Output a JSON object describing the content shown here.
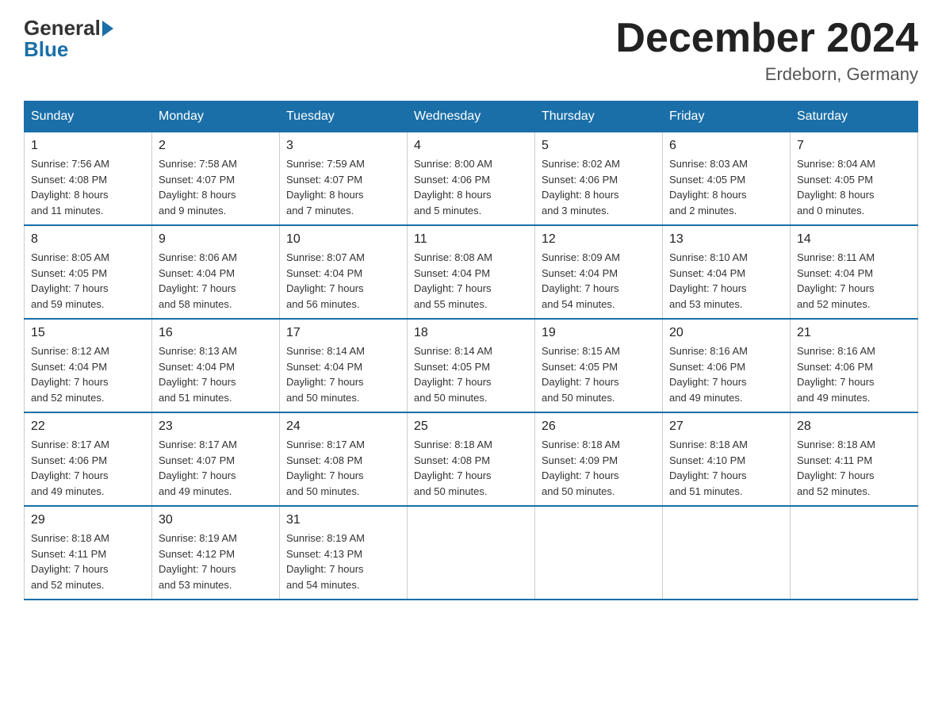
{
  "header": {
    "logo": {
      "general": "General",
      "blue": "Blue"
    },
    "title": "December 2024",
    "subtitle": "Erdeborn, Germany"
  },
  "days_of_week": [
    "Sunday",
    "Monday",
    "Tuesday",
    "Wednesday",
    "Thursday",
    "Friday",
    "Saturday"
  ],
  "weeks": [
    [
      {
        "day": "1",
        "info": "Sunrise: 7:56 AM\nSunset: 4:08 PM\nDaylight: 8 hours\nand 11 minutes."
      },
      {
        "day": "2",
        "info": "Sunrise: 7:58 AM\nSunset: 4:07 PM\nDaylight: 8 hours\nand 9 minutes."
      },
      {
        "day": "3",
        "info": "Sunrise: 7:59 AM\nSunset: 4:07 PM\nDaylight: 8 hours\nand 7 minutes."
      },
      {
        "day": "4",
        "info": "Sunrise: 8:00 AM\nSunset: 4:06 PM\nDaylight: 8 hours\nand 5 minutes."
      },
      {
        "day": "5",
        "info": "Sunrise: 8:02 AM\nSunset: 4:06 PM\nDaylight: 8 hours\nand 3 minutes."
      },
      {
        "day": "6",
        "info": "Sunrise: 8:03 AM\nSunset: 4:05 PM\nDaylight: 8 hours\nand 2 minutes."
      },
      {
        "day": "7",
        "info": "Sunrise: 8:04 AM\nSunset: 4:05 PM\nDaylight: 8 hours\nand 0 minutes."
      }
    ],
    [
      {
        "day": "8",
        "info": "Sunrise: 8:05 AM\nSunset: 4:05 PM\nDaylight: 7 hours\nand 59 minutes."
      },
      {
        "day": "9",
        "info": "Sunrise: 8:06 AM\nSunset: 4:04 PM\nDaylight: 7 hours\nand 58 minutes."
      },
      {
        "day": "10",
        "info": "Sunrise: 8:07 AM\nSunset: 4:04 PM\nDaylight: 7 hours\nand 56 minutes."
      },
      {
        "day": "11",
        "info": "Sunrise: 8:08 AM\nSunset: 4:04 PM\nDaylight: 7 hours\nand 55 minutes."
      },
      {
        "day": "12",
        "info": "Sunrise: 8:09 AM\nSunset: 4:04 PM\nDaylight: 7 hours\nand 54 minutes."
      },
      {
        "day": "13",
        "info": "Sunrise: 8:10 AM\nSunset: 4:04 PM\nDaylight: 7 hours\nand 53 minutes."
      },
      {
        "day": "14",
        "info": "Sunrise: 8:11 AM\nSunset: 4:04 PM\nDaylight: 7 hours\nand 52 minutes."
      }
    ],
    [
      {
        "day": "15",
        "info": "Sunrise: 8:12 AM\nSunset: 4:04 PM\nDaylight: 7 hours\nand 52 minutes."
      },
      {
        "day": "16",
        "info": "Sunrise: 8:13 AM\nSunset: 4:04 PM\nDaylight: 7 hours\nand 51 minutes."
      },
      {
        "day": "17",
        "info": "Sunrise: 8:14 AM\nSunset: 4:04 PM\nDaylight: 7 hours\nand 50 minutes."
      },
      {
        "day": "18",
        "info": "Sunrise: 8:14 AM\nSunset: 4:05 PM\nDaylight: 7 hours\nand 50 minutes."
      },
      {
        "day": "19",
        "info": "Sunrise: 8:15 AM\nSunset: 4:05 PM\nDaylight: 7 hours\nand 50 minutes."
      },
      {
        "day": "20",
        "info": "Sunrise: 8:16 AM\nSunset: 4:06 PM\nDaylight: 7 hours\nand 49 minutes."
      },
      {
        "day": "21",
        "info": "Sunrise: 8:16 AM\nSunset: 4:06 PM\nDaylight: 7 hours\nand 49 minutes."
      }
    ],
    [
      {
        "day": "22",
        "info": "Sunrise: 8:17 AM\nSunset: 4:06 PM\nDaylight: 7 hours\nand 49 minutes."
      },
      {
        "day": "23",
        "info": "Sunrise: 8:17 AM\nSunset: 4:07 PM\nDaylight: 7 hours\nand 49 minutes."
      },
      {
        "day": "24",
        "info": "Sunrise: 8:17 AM\nSunset: 4:08 PM\nDaylight: 7 hours\nand 50 minutes."
      },
      {
        "day": "25",
        "info": "Sunrise: 8:18 AM\nSunset: 4:08 PM\nDaylight: 7 hours\nand 50 minutes."
      },
      {
        "day": "26",
        "info": "Sunrise: 8:18 AM\nSunset: 4:09 PM\nDaylight: 7 hours\nand 50 minutes."
      },
      {
        "day": "27",
        "info": "Sunrise: 8:18 AM\nSunset: 4:10 PM\nDaylight: 7 hours\nand 51 minutes."
      },
      {
        "day": "28",
        "info": "Sunrise: 8:18 AM\nSunset: 4:11 PM\nDaylight: 7 hours\nand 52 minutes."
      }
    ],
    [
      {
        "day": "29",
        "info": "Sunrise: 8:18 AM\nSunset: 4:11 PM\nDaylight: 7 hours\nand 52 minutes."
      },
      {
        "day": "30",
        "info": "Sunrise: 8:19 AM\nSunset: 4:12 PM\nDaylight: 7 hours\nand 53 minutes."
      },
      {
        "day": "31",
        "info": "Sunrise: 8:19 AM\nSunset: 4:13 PM\nDaylight: 7 hours\nand 54 minutes."
      },
      {
        "day": "",
        "info": ""
      },
      {
        "day": "",
        "info": ""
      },
      {
        "day": "",
        "info": ""
      },
      {
        "day": "",
        "info": ""
      }
    ]
  ]
}
